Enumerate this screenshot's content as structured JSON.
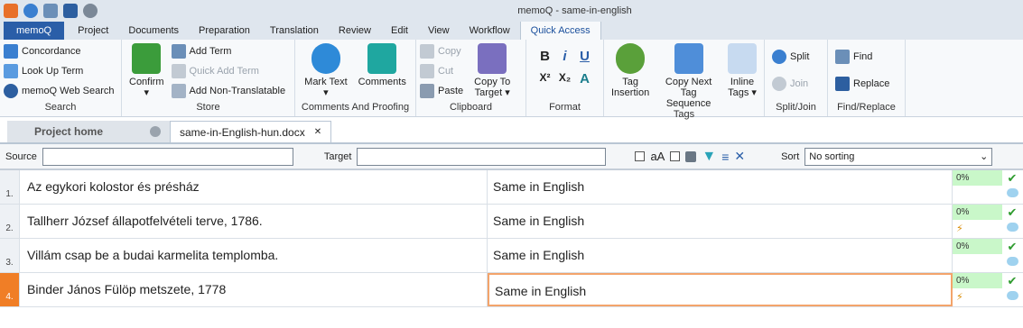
{
  "window": {
    "title": "memoQ - same-in-english"
  },
  "tabs": [
    {
      "label": "memoQ"
    },
    {
      "label": "Project"
    },
    {
      "label": "Documents"
    },
    {
      "label": "Preparation"
    },
    {
      "label": "Translation"
    },
    {
      "label": "Review"
    },
    {
      "label": "Edit"
    },
    {
      "label": "View"
    },
    {
      "label": "Workflow"
    },
    {
      "label": "Quick Access"
    }
  ],
  "ribbon": {
    "search": {
      "label": "Search",
      "concordance": "Concordance",
      "lookup": "Look Up Term",
      "web": "memoQ Web Search"
    },
    "store": {
      "label": "Store",
      "confirm": "Confirm",
      "add_term": "Add Term",
      "quick_add": "Quick Add Term",
      "add_nt": "Add Non-Translatable"
    },
    "comments": {
      "label": "Comments And Proofing",
      "mark_text": "Mark Text",
      "comments": "Comments"
    },
    "clipboard": {
      "label": "Clipboard",
      "copy": "Copy",
      "cut": "Cut",
      "paste": "Paste",
      "copy_to_target": "Copy To",
      "copy_to_target2": "Target"
    },
    "format": {
      "label": "Format",
      "bold": "B",
      "italic": "i",
      "underline": "U",
      "sup": "X²",
      "sub": "X₂",
      "aa": "A"
    },
    "tags": {
      "label": "Tags",
      "tag_insertion1": "Tag",
      "tag_insertion2": "Insertion",
      "copy_next1": "Copy Next",
      "copy_next2": "Tag Sequence",
      "inline1": "Inline",
      "inline2": "Tags"
    },
    "splitjoin": {
      "label": "Split/Join",
      "split": "Split",
      "join": "Join"
    },
    "findreplace": {
      "label": "Find/Replace",
      "find": "Find",
      "replace": "Replace"
    }
  },
  "doc_tabs": {
    "home": "Project home",
    "doc": "same-in-English-hun.docx"
  },
  "filter": {
    "source_label": "Source",
    "target_label": "Target",
    "aa": "aA",
    "sort_label": "Sort",
    "sort_value": "No sorting"
  },
  "rows": [
    {
      "num": "1.",
      "source": "Az egykori kolostor és présház",
      "target": "Same in English",
      "pct": "0%"
    },
    {
      "num": "2.",
      "source": "Tallherr József állapotfelvételi terve, 1786.",
      "target": "Same in English",
      "pct": "0%"
    },
    {
      "num": "3.",
      "source": "Villám csap be a budai karmelita templomba.",
      "target": "Same in English",
      "pct": "0%"
    },
    {
      "num": "4.",
      "source": "Binder János Fülöp metszete, 1778",
      "target": "Same in English",
      "pct": "0%"
    }
  ],
  "colors": {
    "accent": "#2a5ea8",
    "active_row": "#f07e26",
    "match_fill": "#c9f7c9"
  }
}
